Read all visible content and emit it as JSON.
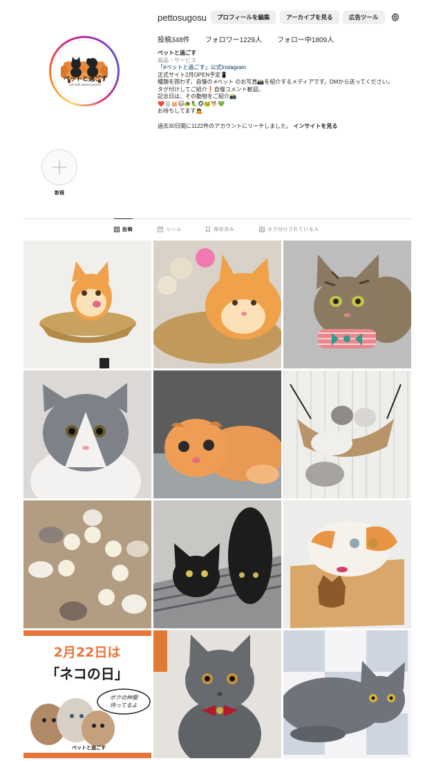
{
  "profile": {
    "username": "pettosugosu",
    "buttons": {
      "edit": "プロフィールを編集",
      "archive": "アーカイブを見る",
      "ad_tools": "広告ツール"
    },
    "stats": {
      "posts": "投稿348件",
      "followers": "フォロワー1229人",
      "following": "フォロー中1809人"
    },
    "bio": {
      "name": "ペットと過ごす",
      "category": "商品・サービス",
      "lines": [
        "「#ペットと過ごす」公式Instagram",
        "正式サイト2月OPEN予定📱",
        "種類を問わず、自慢の #ペット のお写真📸を紹介するメディアです。DMから送ってください。",
        "タグ付けしてご紹介❗自慢コメント歓迎。",
        "記念日は、その動物をご紹介📸",
        "❤️🐰🐹🐱🐢🦜🐵🐸🐕💚",
        "お待ちしてます🙇"
      ]
    },
    "insight": {
      "text": "過去30日間に1122件のアカウントにリーチしました。",
      "link": "インサイトを見る"
    },
    "avatar_logo_text": "ペットと過ごす",
    "avatar_sub_text": "Life with animal partner"
  },
  "highlights": [
    {
      "label": "新規"
    }
  ],
  "tabs": [
    {
      "label": "投稿",
      "icon": "grid-icon",
      "active": true
    },
    {
      "label": "リール",
      "icon": "reels-icon",
      "active": false
    },
    {
      "label": "保存済み",
      "icon": "bookmark-icon",
      "active": false
    },
    {
      "label": "タグ付けされている人",
      "icon": "tagged-icon",
      "active": false
    }
  ],
  "posts": [
    {
      "name": "post-orange-kitten-basket"
    },
    {
      "name": "post-orange-cat-with-plush-toys"
    },
    {
      "name": "post-tabby-cat-bowtie"
    },
    {
      "name": "post-gray-white-cat"
    },
    {
      "name": "post-orange-scottish-fold"
    },
    {
      "name": "post-cats-in-hammock"
    },
    {
      "name": "post-kittens-eating"
    },
    {
      "name": "post-two-black-cats"
    },
    {
      "name": "post-calico-cat-in-box"
    },
    {
      "name": "post-cat-day-announcement"
    },
    {
      "name": "post-gray-cat-red-bow"
    },
    {
      "name": "post-gray-cat-lying"
    }
  ],
  "cat_day_post": {
    "headline_line1": "2月22日は",
    "headline_line2": "「ネコの日」",
    "bubble_line1": "ボクの仲間",
    "bubble_line2": "待ってるよ",
    "logo": "ペットと過ごす"
  },
  "colors": {
    "accent_blue": "#00376b",
    "button_gray": "#efefef",
    "banner_orange": "#e8753a"
  }
}
